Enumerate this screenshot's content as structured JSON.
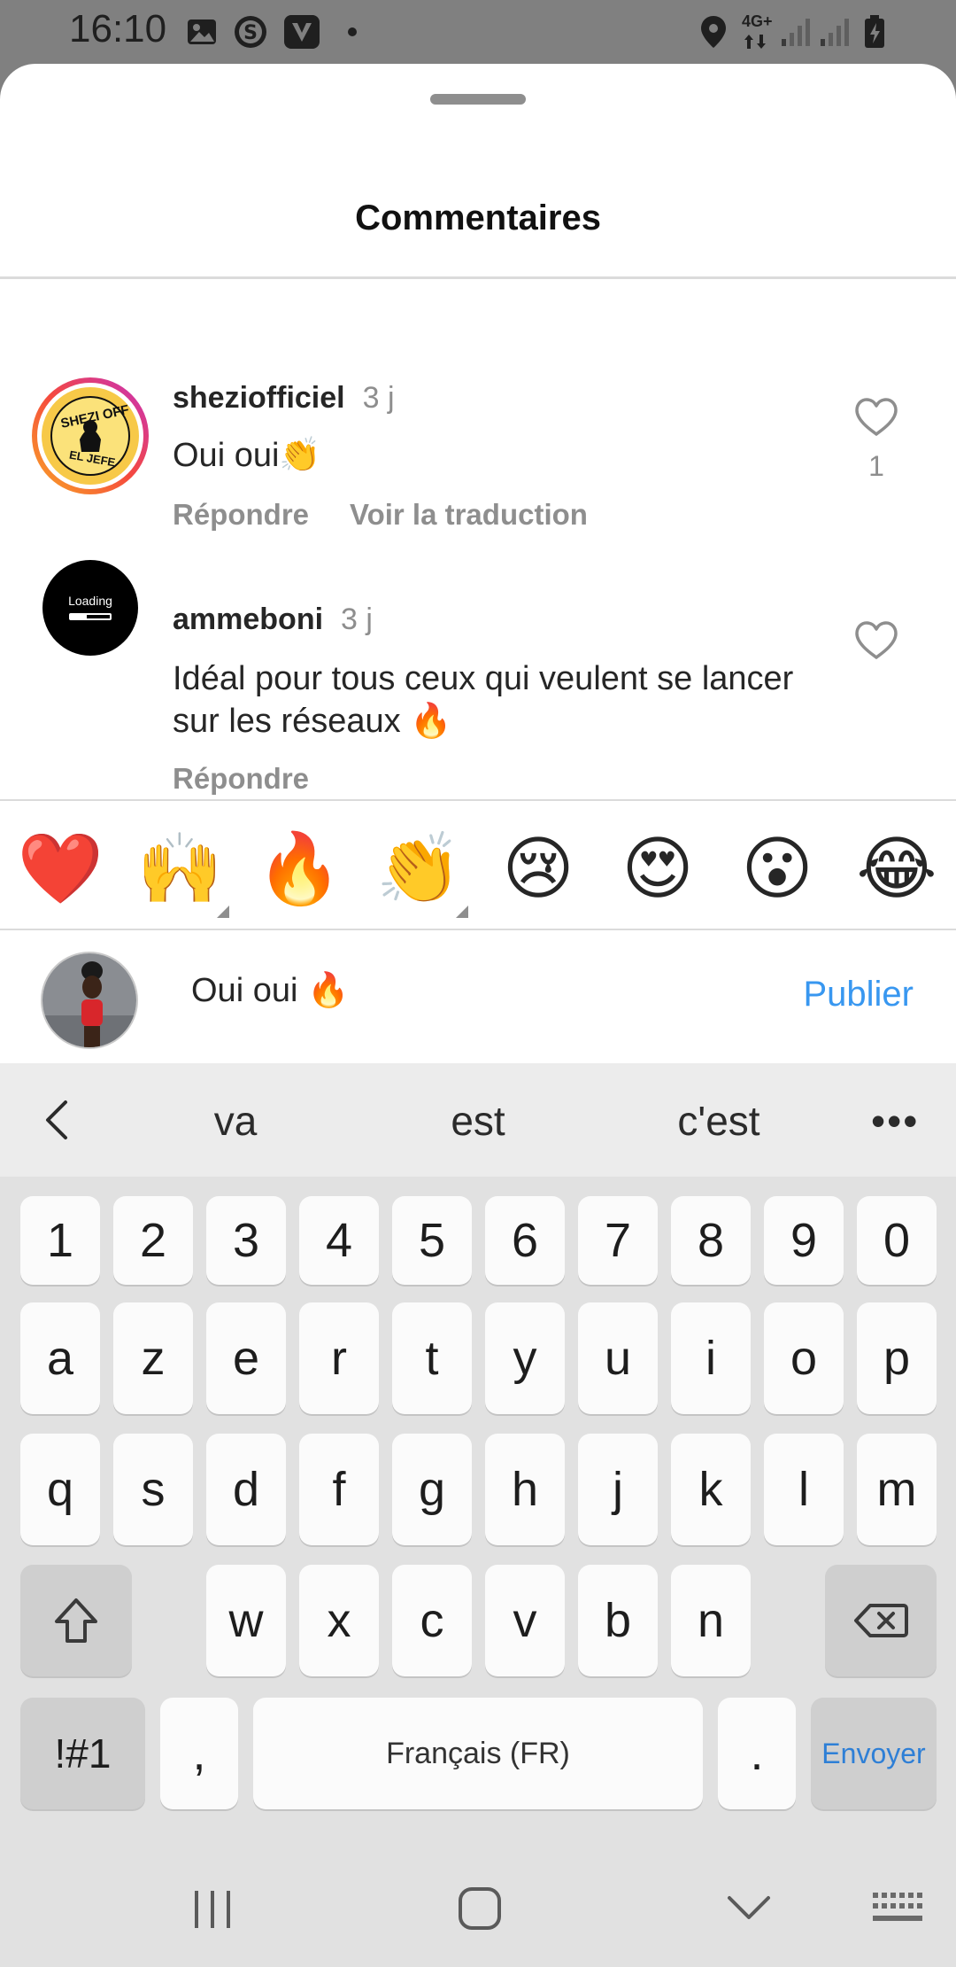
{
  "status_bar": {
    "time": "16:10",
    "network_label": "4G+",
    "icons": [
      "gallery-icon",
      "s-app-icon",
      "v-app-icon",
      "dot-icon",
      "location-icon",
      "signal-icon",
      "signal-icon",
      "battery-charging-icon"
    ]
  },
  "sheet": {
    "title": "Commentaires"
  },
  "comments": [
    {
      "username": "sheziofficiel",
      "time": "3 j",
      "text": "Oui oui👏",
      "actions": [
        "Répondre",
        "Voir la traduction"
      ],
      "likes": "1",
      "avatar_text": [
        "SHEZI OFF",
        "EL JEFE"
      ]
    },
    {
      "username": "ammeboni",
      "time": "3 j",
      "text": "Idéal pour tous ceux qui veulent se lancer sur les réseaux 🔥",
      "actions": [
        "Répondre"
      ],
      "avatar_text": [
        "Loading"
      ]
    }
  ],
  "emoji_bar": {
    "emojis": [
      "❤️",
      "🙌",
      "🔥",
      "👏",
      "😢",
      "😍",
      "😮",
      "😂"
    ]
  },
  "composer": {
    "value": "Oui oui 🔥",
    "publish_label": "Publier"
  },
  "keyboard": {
    "suggestions": [
      "va",
      "est",
      "c'est"
    ],
    "more": "•••",
    "row_numbers": [
      "1",
      "2",
      "3",
      "4",
      "5",
      "6",
      "7",
      "8",
      "9",
      "0"
    ],
    "row_1": [
      "a",
      "z",
      "e",
      "r",
      "t",
      "y",
      "u",
      "i",
      "o",
      "p"
    ],
    "row_2": [
      "q",
      "s",
      "d",
      "f",
      "g",
      "h",
      "j",
      "k",
      "l",
      "m"
    ],
    "row_3": [
      "w",
      "x",
      "c",
      "v",
      "b",
      "n"
    ],
    "symbols_label": "!#1",
    "comma_label": ",",
    "space_label": "Français (FR)",
    "period_label": ".",
    "enter_label": "Envoyer"
  },
  "colors": {
    "accent": "#3897f0",
    "sheet_background": "#ffffff",
    "keyboard_background": "#e1e1e1",
    "status_bar_background": "#808080",
    "secondary_text": "#8e8e8e"
  }
}
